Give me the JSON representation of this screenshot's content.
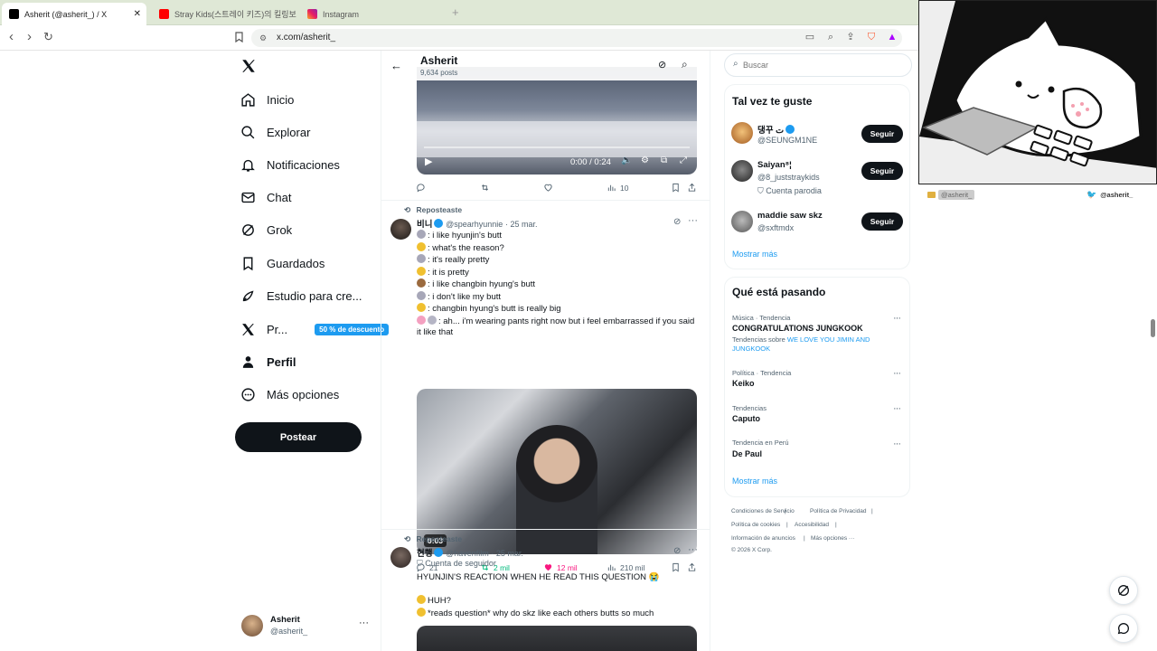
{
  "browser": {
    "tabs": [
      {
        "title": "Asherit (@asherit_) / X",
        "active": true
      },
      {
        "title": "Stray Kids(스트레이 키즈)의 킬링보이스..."
      },
      {
        "title": "Instagram"
      }
    ],
    "url": "x.com/asherit_"
  },
  "nav": {
    "items": [
      {
        "label": "Inicio"
      },
      {
        "label": "Explorar"
      },
      {
        "label": "Notificaciones"
      },
      {
        "label": "Chat"
      },
      {
        "label": "Grok"
      },
      {
        "label": "Guardados"
      },
      {
        "label": "Estudio para cre..."
      },
      {
        "label": "Pr...",
        "badge": "50 % de descuento"
      },
      {
        "label": "Perfil"
      },
      {
        "label": "Más opciones"
      }
    ],
    "post_label": "Postear",
    "account": {
      "name": "Asherit",
      "handle": "@asherit_"
    }
  },
  "profile_header": {
    "name": "Asherit",
    "posts": "9,634 posts"
  },
  "video1": {
    "time": "0:00 / 0:24",
    "views": "10"
  },
  "tweet1": {
    "repost_label": "Reposteaste",
    "author": "비니",
    "handle": "@spearhyunnie",
    "date": "· 25 mar.",
    "lines": [
      ": i like hyunjin's butt",
      ": what's the reason?",
      ": it's really pretty",
      ": it is pretty",
      ": i like changbin hyung's butt",
      ": i don't like my butt",
      ": changbin hyung's butt is really big",
      ": ah... i'm wearing pants right now but i feel embarrassed if you said it like that"
    ],
    "video_time": "0:03",
    "replies": "21",
    "reposts": "2 mil",
    "likes": "12 mil",
    "views": "210 mil"
  },
  "tweet2": {
    "repost_label": "Reposteaste",
    "author": "현행",
    "handle": "@havenfilm",
    "date": "· 25 mar.",
    "account_type": "Cuenta de seguidor",
    "lines": [
      "HYUNJIN'S REACTION WHEN HE READ THIS QUESTION 😭",
      "HUH?",
      "*reads question* why do skz like each others butts so much"
    ]
  },
  "search": {
    "placeholder": "Buscar"
  },
  "who_to_follow": {
    "title": "Tal vez te guste",
    "follow_label": "Seguir",
    "users": [
      {
        "name": "댕꾸 ت",
        "handle": "@SEUNGM1NE"
      },
      {
        "name": "Saiyan⁸¦",
        "handle": "@8_juststraykids",
        "note": "Cuenta parodia"
      },
      {
        "name": "maddie saw skz",
        "handle": "@sxftmdx"
      }
    ],
    "show_more": "Mostrar más"
  },
  "trends": {
    "title": "Qué está pasando",
    "items": [
      {
        "category": "Música · Tendencia",
        "name": "CONGRATULATIONS JUNGKOOK",
        "sub_prefix": "Tendencias sobre",
        "sub_link": "WE LOVE YOU JIMIN AND JUNGKOOK"
      },
      {
        "category": "Política · Tendencia",
        "name": "Keiko"
      },
      {
        "category": "Tendencias",
        "name": "Caputo"
      },
      {
        "category": "Tendencia en Perú",
        "name": "De Paul"
      }
    ],
    "show_more": "Mostrar más"
  },
  "footer": {
    "links": [
      "Condiciones de Servicio",
      "Política de Privacidad",
      "Política de cookies",
      "Accesibilidad",
      "Información de anuncios",
      "Más opciones ···"
    ],
    "copyright": "© 2026 X Corp."
  },
  "overlay": {
    "left_tag": "@asherit_",
    "right_tag": "@asherit_"
  },
  "colors": {
    "accent": "#1d9bf0",
    "like": "#f91880",
    "repost": "#00ba7c",
    "dark": "#0f1419"
  }
}
